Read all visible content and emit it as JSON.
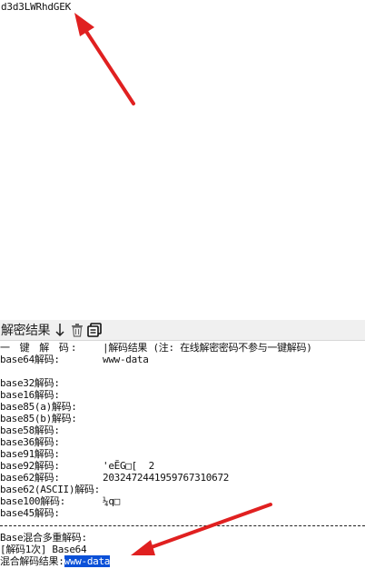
{
  "top": {
    "encoded_text": "d3d3LWRhdGEK"
  },
  "toolbar": {
    "title": "解密结果",
    "icons": [
      "arrow-down-icon",
      "trash-icon",
      "copy-icon"
    ]
  },
  "header": {
    "label": "一 键 解 码:",
    "value": "|解码结果 (注: 在线解密密码不参与一键解码)"
  },
  "rows": [
    {
      "label": "base64解码:",
      "value": "www-data"
    },
    {
      "label": "",
      "value": ""
    },
    {
      "label": "base32解码:",
      "value": ""
    },
    {
      "label": "base16解码:",
      "value": ""
    },
    {
      "label": "base85(a)解码:",
      "value": ""
    },
    {
      "label": "base85(b)解码:",
      "value": ""
    },
    {
      "label": "base58解码:",
      "value": ""
    },
    {
      "label": "base36解码:",
      "value": ""
    },
    {
      "label": "base91解码:",
      "value": ""
    },
    {
      "label": "base92解码:",
      "value": "'eĔG□[  2"
    },
    {
      "label": "base62解码:",
      "value": "20324724419597673106​72"
    },
    {
      "label": "base62(ASCII)解码:",
      "value": ""
    },
    {
      "label": "base100解码:",
      "value": "¼q□"
    },
    {
      "label": "base45解码:",
      "value": ""
    }
  ],
  "mixed": {
    "title": "Base混合多重解码:",
    "step": "[解码1次] Base64",
    "result_label": "混合解码结果:",
    "result_value": "www-data"
  },
  "colors": {
    "arrow": "#e02020",
    "highlight": "#0a50d8"
  }
}
